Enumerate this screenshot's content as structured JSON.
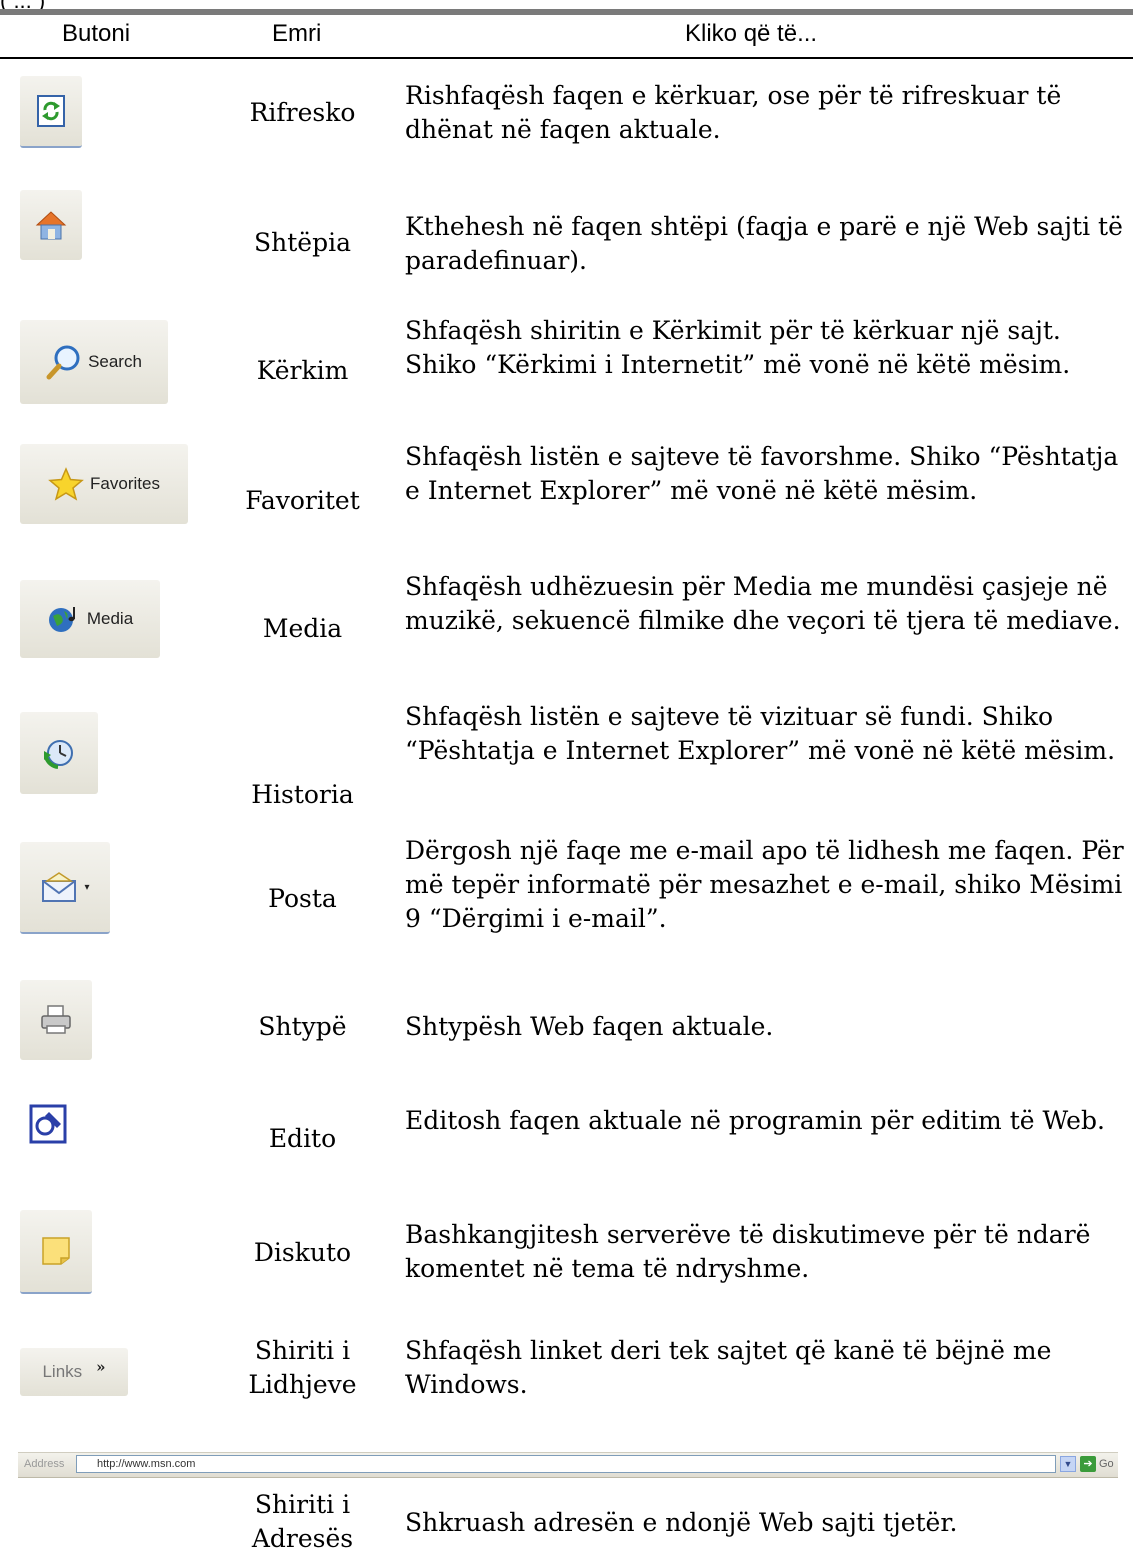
{
  "caption_fragment": "(   ...   )",
  "headers": {
    "button": "Butoni",
    "name": "Emri",
    "click_to": "Kliko që të..."
  },
  "rows": [
    {
      "name": "Rifresko",
      "desc": "Rishfaqësh faqen e kërkuar, ose për të rifreskuar të dhënat në faqen aktuale.",
      "icon": "refresh-icon"
    },
    {
      "name": "Shtëpia",
      "desc": "Kthehesh në faqen shtëpi (faqja e parë e një Web sajti të paradefinuar).",
      "icon": "home-icon"
    },
    {
      "name": "Kërkim",
      "desc": "Shfaqësh shiritin e Kërkimit për të kërkuar një sajt. Shiko “Kërkimi i Internetit” më vonë në këtë mësim.",
      "icon": "search-icon",
      "button_label": "Search"
    },
    {
      "name": "Favoritet",
      "desc": "Shfaqësh listën e sajteve të favorshme. Shiko “Pështatja e Internet Explorer” më vonë në këtë mësim.",
      "icon": "star-icon",
      "button_label": "Favorites"
    },
    {
      "name": "Media",
      "desc": "Shfaqësh udhëzuesin për Media me mundësi çasjeje në muzikë, sekuencë filmike dhe veçori të tjera të mediave.",
      "icon": "globe-music-icon",
      "button_label": "Media"
    },
    {
      "name": "Historia",
      "desc": "Shfaqësh listën e sajteve të vizituar së fundi. Shiko “Pështatja e Internet Explorer” më vonë në këtë mësim.",
      "icon": "history-clock-icon"
    },
    {
      "name": "Posta",
      "desc": "Dërgosh një faqe me e-mail apo të lidhesh me faqen. Për më tepër informatë për mesazhet e e-mail, shiko Mësimi 9 “Dërgimi i e-mail”.",
      "icon": "mail-envelope-icon"
    },
    {
      "name": "Shtypë",
      "desc": "Shtypësh Web faqen aktuale.",
      "icon": "printer-icon"
    },
    {
      "name": "Edito",
      "desc": "Editosh faqen aktuale në programin për editim të Web.",
      "icon": "edit-pen-icon"
    },
    {
      "name": "Diskuto",
      "desc": "Bashkangjitesh serverëve të diskutimeve për të ndarë komentet në tema të ndryshme.",
      "icon": "note-icon"
    },
    {
      "name": "Shiriti i Lidhjeve",
      "desc": "Shfaqësh linket deri tek sajtet që kanë të bëjnë me Windows.",
      "icon": "links-chevron-icon",
      "button_label": "Links"
    },
    {
      "name": "Shiriti i Adresës",
      "desc": "Shkruash adresën e ndonjë Web sajti tjetër.",
      "icon": "address-bar"
    }
  ],
  "address_bar": {
    "label": "Address",
    "url": "http://www.msn.com",
    "go_label": "Go"
  }
}
